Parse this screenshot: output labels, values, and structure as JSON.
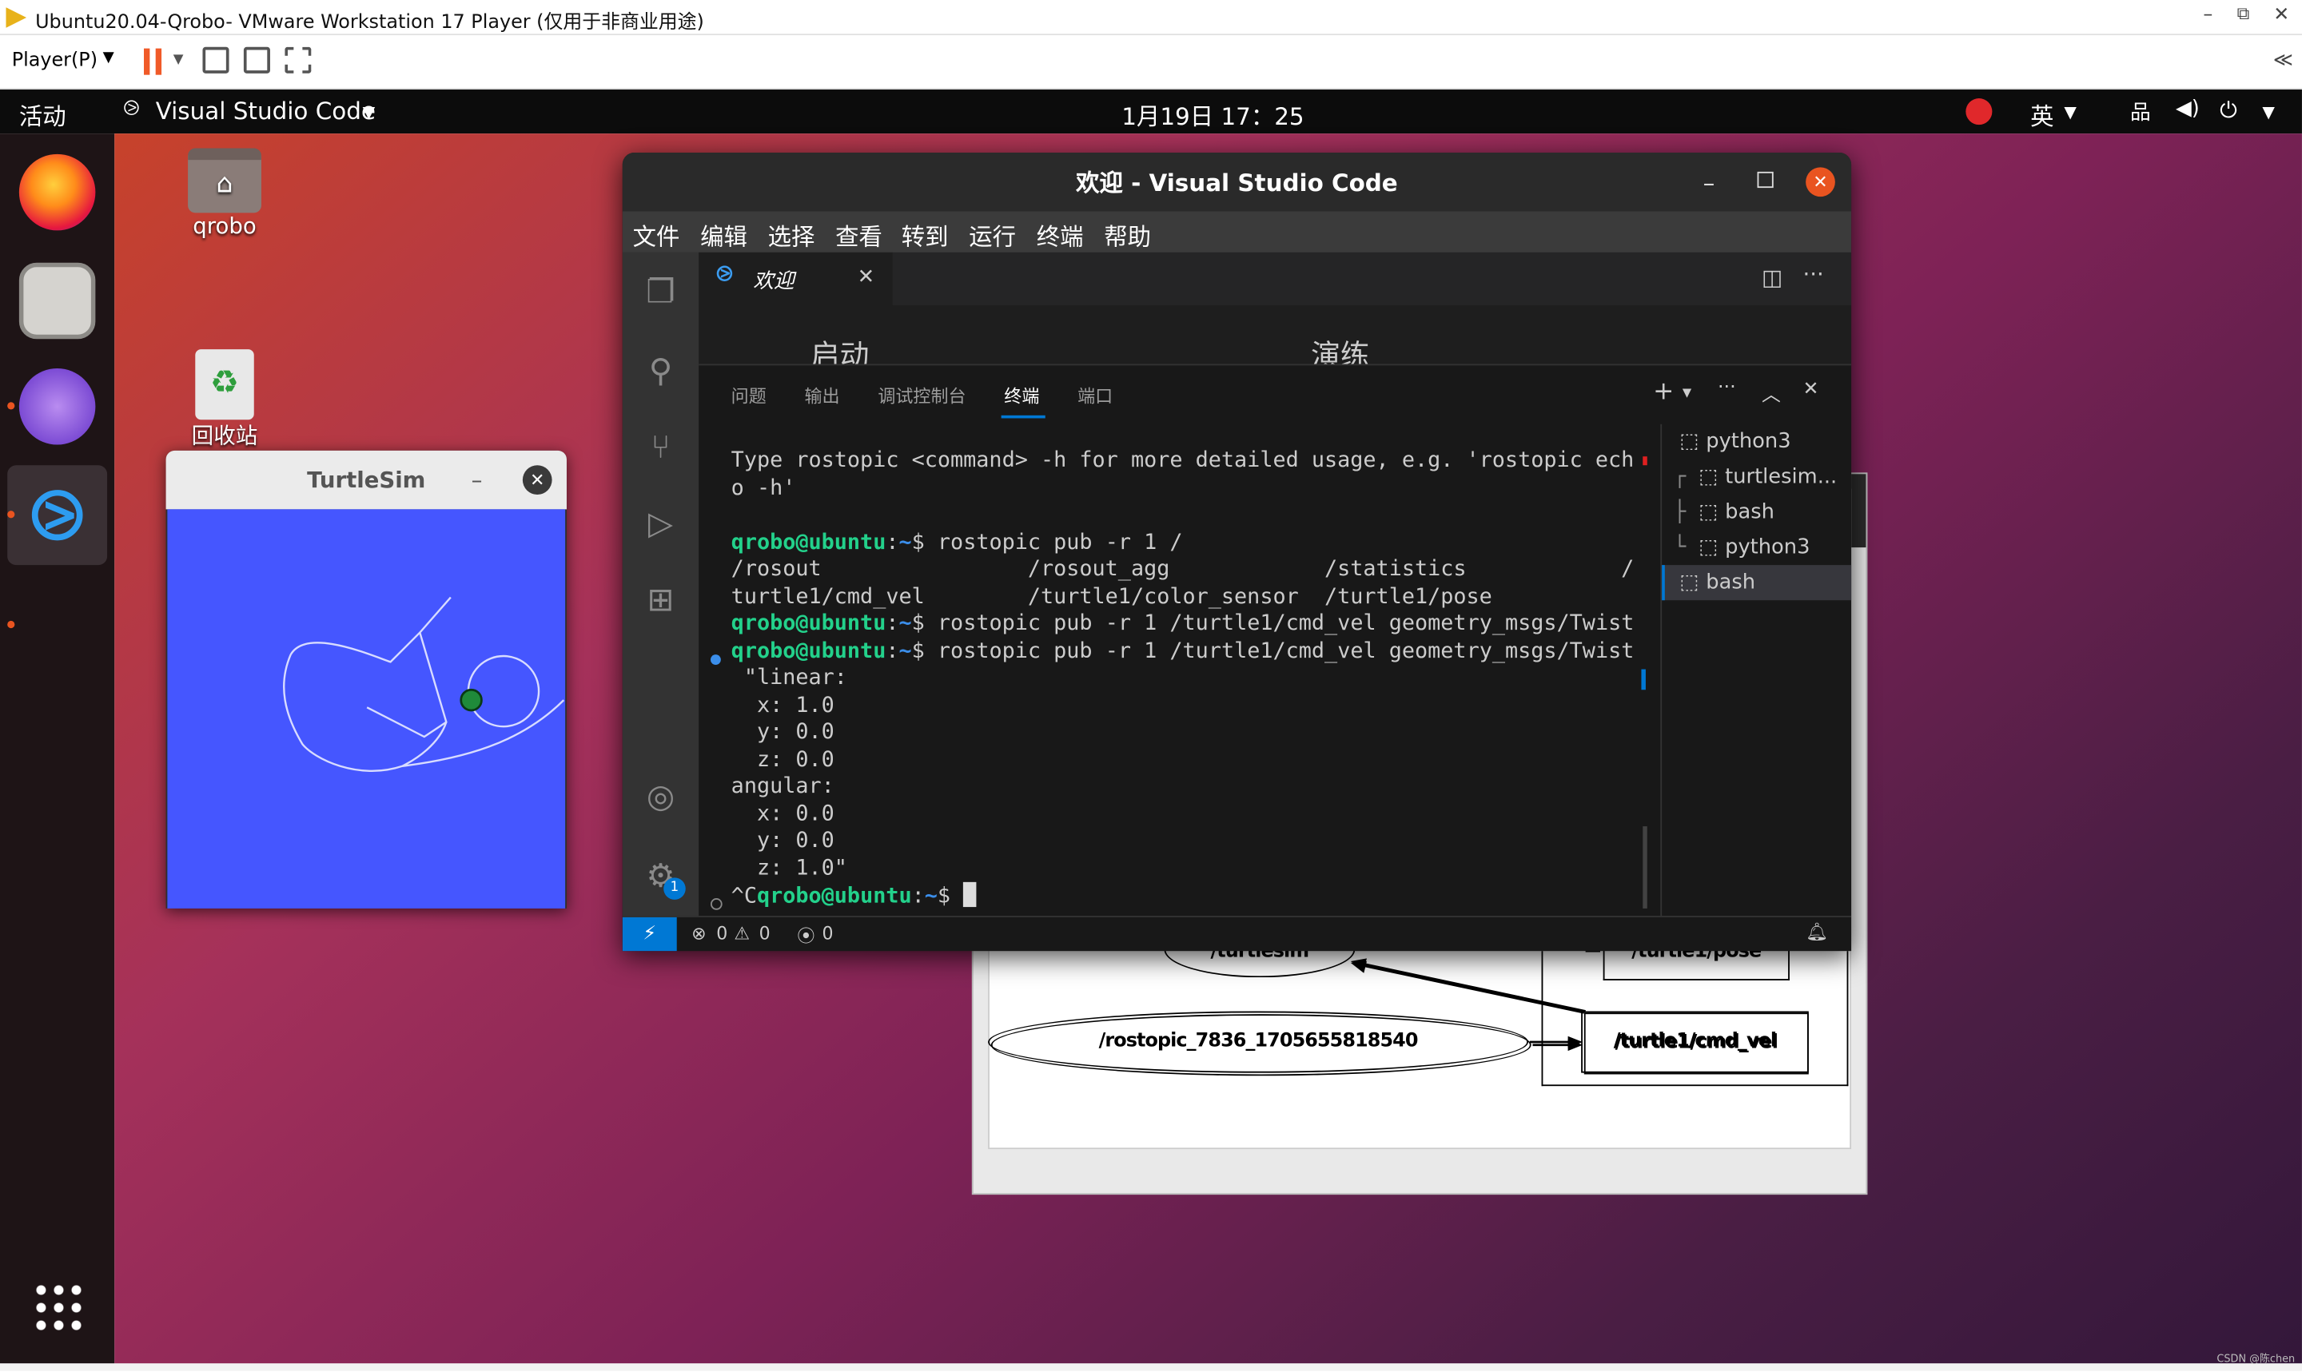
{
  "vmware": {
    "window_title": "Ubuntu20.04-Qrobo- VMware Workstation 17 Player (仅用于非商业用途)",
    "player_menu": "Player(P)",
    "collapse_glyph": "≪"
  },
  "ubuntu": {
    "activities": "活动",
    "app_menu": "Visual Studio Code",
    "clock": "1月19日  17：25",
    "input_method": "英"
  },
  "desktop": {
    "home_icon_label": "qrobo",
    "trash_icon_label": "回收站"
  },
  "turtlesim": {
    "title": "TurtleSim",
    "background": "#4556ff"
  },
  "rqt_graph": {
    "nodes": [
      "/turtlesim",
      "/turtle1/pose",
      "/rostopic_7836_1705655818540",
      "/turtle1/cmd_vel"
    ]
  },
  "vscode": {
    "title": "欢迎 - Visual Studio Code",
    "menu": [
      "文件",
      "编辑",
      "选择",
      "查看",
      "转到",
      "运行",
      "终端",
      "帮助"
    ],
    "tab_label": "欢迎",
    "editor_headings": [
      "启动",
      "演练"
    ],
    "panel_tabs": [
      "问题",
      "输出",
      "调试控制台",
      "终端",
      "端口"
    ],
    "active_panel_tab": "终端",
    "settings_badge": "1",
    "terminal_lines": [
      "Type rostopic <command> -h for more detailed usage, e.g. 'rostopic ech",
      "o -h'",
      "",
      "qrobo@ubuntu:~$ rostopic pub -r 1 /",
      "/rosout                /rosout_agg            /statistics            /",
      "turtle1/cmd_vel        /turtle1/color_sensor  /turtle1/pose",
      "qrobo@ubuntu:~$ rostopic pub -r 1 /turtle1/cmd_vel geometry_msgs/Twist",
      "qrobo@ubuntu:~$ rostopic pub -r 1 /turtle1/cmd_vel geometry_msgs/Twist",
      " \"linear:",
      "  x: 1.0",
      "  y: 0.0",
      "  z: 0.0",
      "angular:",
      "  x: 0.0",
      "  y: 0.0",
      "  z: 1.0\"",
      "^Cqrobo@ubuntu:~$ "
    ],
    "terminals": [
      {
        "name": "python3",
        "prefix": ""
      },
      {
        "name": "turtlesim...",
        "prefix": "┌"
      },
      {
        "name": "bash",
        "prefix": "├"
      },
      {
        "name": "python3",
        "prefix": "└"
      },
      {
        "name": "bash",
        "prefix": ""
      }
    ],
    "status": {
      "errors": "0",
      "warnings": "0",
      "ports": "0"
    }
  },
  "watermark": "CSDN @陈chen"
}
